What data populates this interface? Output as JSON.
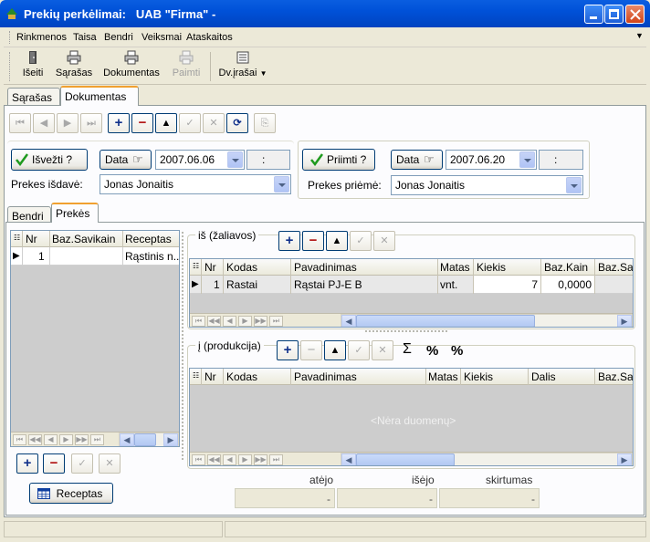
{
  "window": {
    "title": "Prekių perkėlimai:   UAB \"Firma\" -"
  },
  "menu": [
    "Rinkmenos",
    "Taisa",
    "Bendri",
    "Veiksmai",
    "Ataskaitos"
  ],
  "toolbar": {
    "exit": "Išeiti",
    "list": "Sąrašas",
    "document": "Dokumentas",
    "print": "Paimti",
    "entries": "Dv.įrašai"
  },
  "tabs": {
    "list": "Sąrašas",
    "document": "Dokumentas"
  },
  "left_panel": {
    "button": "Išvežti ?",
    "date_button": "Data",
    "date": "2007.06.06",
    "time": ":",
    "person_label": "Prekes išdavė:",
    "person": "Jonas Jonaitis"
  },
  "right_panel": {
    "button": "Priimti ?",
    "date_button": "Data",
    "date": "2007.06.20",
    "time": ":",
    "person_label": "Prekes priėmė:",
    "person": "Jonas Jonaitis"
  },
  "subtabs": {
    "general": "Bendri",
    "goods": "Prekės"
  },
  "recipe_grid": {
    "headers": [
      "Nr",
      "Baz.Savikain",
      "Receptas"
    ],
    "rows": [
      {
        "nr": "1",
        "cost": "",
        "recipe": "Rąstinis n..."
      }
    ]
  },
  "recipe_button": "Receptas",
  "raw_group": {
    "title": "iš (žaliavos)",
    "headers": [
      "Nr",
      "Kodas",
      "Pavadinimas",
      "Matas",
      "Kiekis",
      "Baz.Kain",
      "Baz.Sa"
    ],
    "rows": [
      {
        "nr": "1",
        "code": "Rastai",
        "name": "Rąstai PJ-E B",
        "unit": "vnt.",
        "qty": "7",
        "price": "0,0000"
      }
    ]
  },
  "product_group": {
    "title": "į (produkcija)",
    "headers": [
      "Nr",
      "Kodas",
      "Pavadinimas",
      "Matas",
      "Kiekis",
      "Dalis",
      "Baz.Sa"
    ],
    "empty": "<Nėra duomenų>",
    "sum_symbol": "Σ",
    "pct_symbol": "%",
    "pct_split_symbol": "%"
  },
  "summary": {
    "labels": [
      "atėjo",
      "išėjo",
      "skirtumas"
    ],
    "values": [
      "-",
      "-",
      "-"
    ]
  },
  "colors": {
    "title_blue": "#0054e3",
    "accent_orange": "#f0a030",
    "check_green": "#1e9a1e"
  }
}
